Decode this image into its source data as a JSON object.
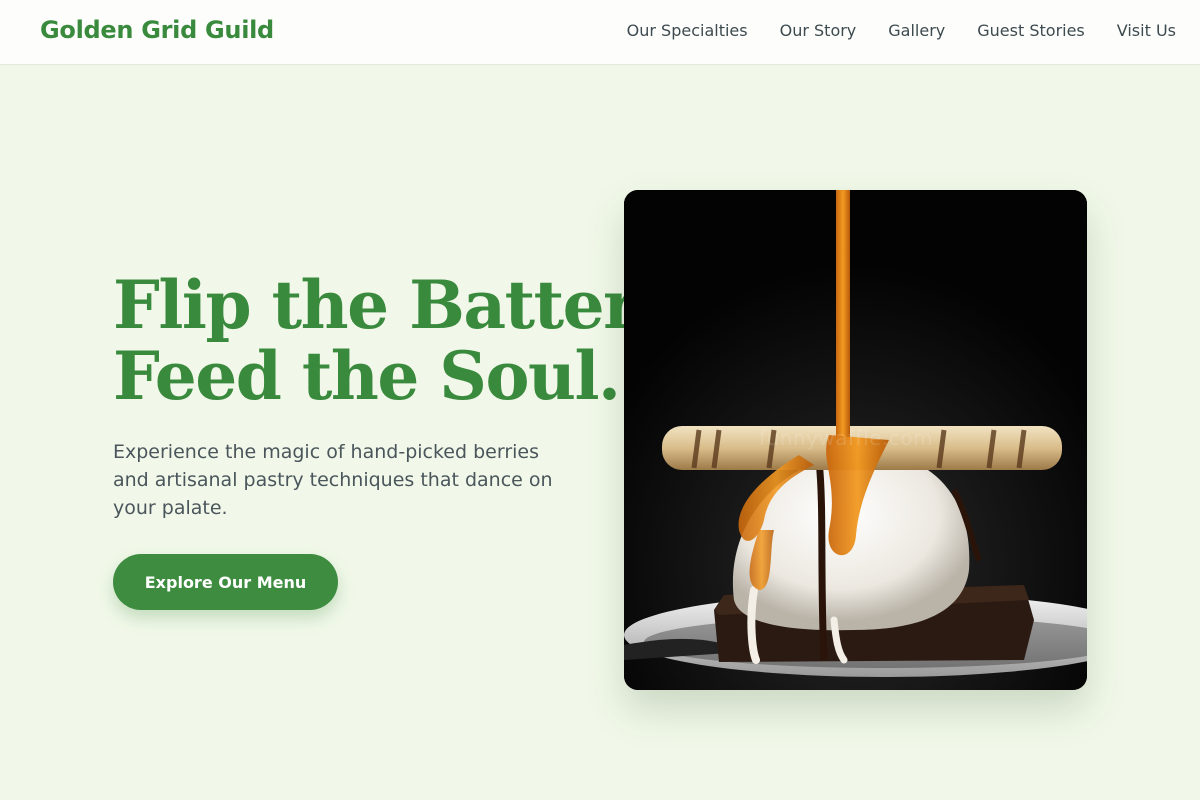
{
  "header": {
    "brand": "Golden Grid Guild",
    "nav": [
      {
        "label": "Our Specialties"
      },
      {
        "label": "Our Story"
      },
      {
        "label": "Gallery"
      },
      {
        "label": "Guest Stories"
      },
      {
        "label": "Visit Us"
      }
    ]
  },
  "hero": {
    "title_line1": "Flip the Batter,",
    "title_line2": "Feed the Soul.",
    "subtitle": "Experience the magic of hand-picked berries and artisanal pastry techniques that dance on your palate.",
    "cta_label": "Explore Our Menu",
    "image_watermark": "funnywaffle.com"
  },
  "colors": {
    "background": "#f1f8e9",
    "brand_green": "#3a8a3e",
    "button_green": "#3d8c40",
    "body_text": "#4a565c",
    "nav_text": "#3d4a4f"
  }
}
